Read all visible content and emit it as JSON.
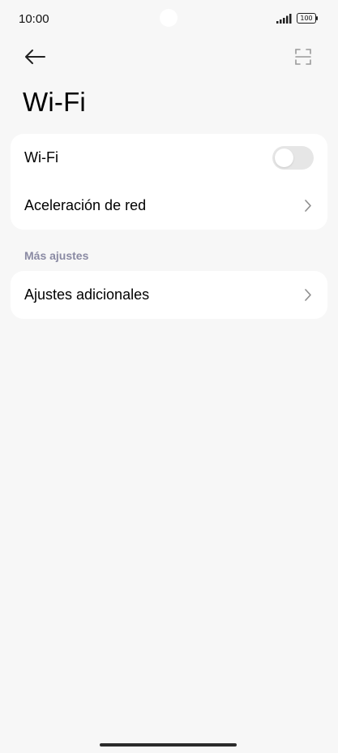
{
  "status_bar": {
    "time": "10:00",
    "battery_level": "100",
    "icons": [
      "signal-icon",
      "battery-icon"
    ]
  },
  "header": {
    "back_icon": "arrow-left-icon",
    "scan_icon": "scan-icon"
  },
  "page": {
    "title": "Wi-Fi"
  },
  "main_card": {
    "wifi_label": "Wi-Fi",
    "wifi_enabled": false,
    "network_acceleration_label": "Aceleración de red"
  },
  "more_settings": {
    "header": "Más ajustes",
    "additional_settings_label": "Ajustes adicionales"
  },
  "colors": {
    "background": "#f7f7f7",
    "card": "#ffffff",
    "section_header": "#8a8aa3",
    "toggle_off": "#e6e6e6"
  }
}
